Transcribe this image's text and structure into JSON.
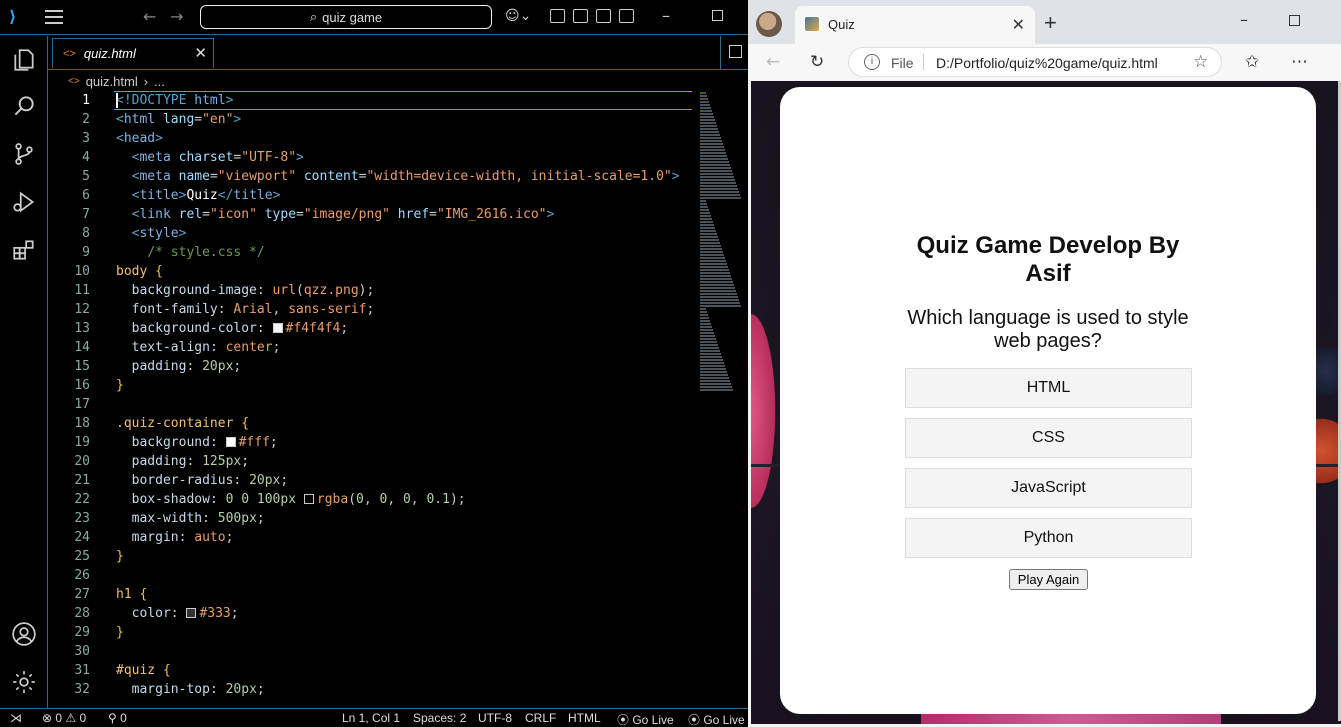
{
  "vscode": {
    "command_center": "quiz game",
    "tab": {
      "icon": "<>",
      "label": "quiz.html"
    },
    "breadcrumb": {
      "file": "quiz.html",
      "rest": "..."
    },
    "lines": [
      {
        "n": "1",
        "tokens": [
          [
            "t-tag",
            "<!DOCTYPE "
          ],
          [
            "t-name",
            "html"
          ],
          [
            "t-tag",
            ">"
          ]
        ]
      },
      {
        "n": "2",
        "tokens": [
          [
            "t-tag",
            "<"
          ],
          [
            "t-name",
            "html "
          ],
          [
            "t-attr",
            "lang"
          ],
          [
            "t-pun",
            "="
          ],
          [
            "t-str",
            "\"en\""
          ],
          [
            "t-tag",
            ">"
          ]
        ]
      },
      {
        "n": "3",
        "tokens": [
          [
            "t-tag",
            "<"
          ],
          [
            "t-name",
            "head"
          ],
          [
            "t-tag",
            ">"
          ]
        ]
      },
      {
        "n": "4",
        "tokens": [
          [
            "t-pun",
            "  "
          ],
          [
            "t-tag",
            "<"
          ],
          [
            "t-name",
            "meta "
          ],
          [
            "t-attr",
            "charset"
          ],
          [
            "t-pun",
            "="
          ],
          [
            "t-str",
            "\"UTF-8\""
          ],
          [
            "t-tag",
            ">"
          ]
        ]
      },
      {
        "n": "5",
        "tokens": [
          [
            "t-pun",
            "  "
          ],
          [
            "t-tag",
            "<"
          ],
          [
            "t-name",
            "meta "
          ],
          [
            "t-attr",
            "name"
          ],
          [
            "t-pun",
            "="
          ],
          [
            "t-str",
            "\"viewport\" "
          ],
          [
            "t-attr",
            "content"
          ],
          [
            "t-pun",
            "="
          ],
          [
            "t-str",
            "\"width=device-width, initial-scale=1.0\""
          ],
          [
            "t-tag",
            ">"
          ]
        ]
      },
      {
        "n": "6",
        "tokens": [
          [
            "t-pun",
            "  "
          ],
          [
            "t-tag",
            "<"
          ],
          [
            "t-name",
            "title"
          ],
          [
            "t-tag",
            ">"
          ],
          [
            "t-txt",
            "Quiz"
          ],
          [
            "t-tag",
            "</"
          ],
          [
            "t-name",
            "title"
          ],
          [
            "t-tag",
            ">"
          ]
        ]
      },
      {
        "n": "7",
        "tokens": [
          [
            "t-pun",
            "  "
          ],
          [
            "t-tag",
            "<"
          ],
          [
            "t-name",
            "link "
          ],
          [
            "t-attr",
            "rel"
          ],
          [
            "t-pun",
            "="
          ],
          [
            "t-str",
            "\"icon\" "
          ],
          [
            "t-attr",
            "type"
          ],
          [
            "t-pun",
            "="
          ],
          [
            "t-str",
            "\"image/png\" "
          ],
          [
            "t-attr",
            "href"
          ],
          [
            "t-pun",
            "="
          ],
          [
            "t-str",
            "\"IMG_2616.ico\""
          ],
          [
            "t-tag",
            ">"
          ]
        ]
      },
      {
        "n": "8",
        "tokens": [
          [
            "t-pun",
            "  "
          ],
          [
            "t-tag",
            "<"
          ],
          [
            "t-name",
            "style"
          ],
          [
            "t-tag",
            ">"
          ]
        ]
      },
      {
        "n": "9",
        "tokens": [
          [
            "t-pun",
            "    "
          ],
          [
            "t-com",
            "/* style.css */"
          ]
        ]
      },
      {
        "n": "10",
        "tokens": [
          [
            "t-sel",
            "body "
          ],
          [
            "t-brace",
            "{"
          ]
        ]
      },
      {
        "n": "11",
        "tokens": [
          [
            "t-pun",
            "  "
          ],
          [
            "t-prop",
            "background-image"
          ],
          [
            "t-pun",
            ": "
          ],
          [
            "t-val",
            "url"
          ],
          [
            "t-pun",
            "("
          ],
          [
            "t-val",
            "qzz.png"
          ],
          [
            "t-pun",
            ");"
          ]
        ]
      },
      {
        "n": "12",
        "tokens": [
          [
            "t-pun",
            "  "
          ],
          [
            "t-prop",
            "font-family"
          ],
          [
            "t-pun",
            ": "
          ],
          [
            "t-val",
            "Arial"
          ],
          [
            "t-pun",
            ", "
          ],
          [
            "t-val",
            "sans-serif"
          ],
          [
            "t-pun",
            ";"
          ]
        ]
      },
      {
        "n": "13",
        "tokens": [
          [
            "t-pun",
            "  "
          ],
          [
            "t-prop",
            "background-color"
          ],
          [
            "t-pun",
            ": "
          ],
          [
            "swatch",
            "#f4f4f4"
          ],
          [
            "t-val",
            "#f4f4f4"
          ],
          [
            "t-pun",
            ";"
          ]
        ]
      },
      {
        "n": "14",
        "tokens": [
          [
            "t-pun",
            "  "
          ],
          [
            "t-prop",
            "text-align"
          ],
          [
            "t-pun",
            ": "
          ],
          [
            "t-val",
            "center"
          ],
          [
            "t-pun",
            ";"
          ]
        ]
      },
      {
        "n": "15",
        "tokens": [
          [
            "t-pun",
            "  "
          ],
          [
            "t-prop",
            "padding"
          ],
          [
            "t-pun",
            ": "
          ],
          [
            "t-num",
            "20px"
          ],
          [
            "t-pun",
            ";"
          ]
        ]
      },
      {
        "n": "16",
        "tokens": [
          [
            "t-brace",
            "}"
          ]
        ]
      },
      {
        "n": "17",
        "tokens": []
      },
      {
        "n": "18",
        "tokens": [
          [
            "t-sel",
            ".quiz-container "
          ],
          [
            "t-brace",
            "{"
          ]
        ]
      },
      {
        "n": "19",
        "tokens": [
          [
            "t-pun",
            "  "
          ],
          [
            "t-prop",
            "background"
          ],
          [
            "t-pun",
            ": "
          ],
          [
            "swatch",
            "#ffffff"
          ],
          [
            "t-val",
            "#fff"
          ],
          [
            "t-pun",
            ";"
          ]
        ]
      },
      {
        "n": "20",
        "tokens": [
          [
            "t-pun",
            "  "
          ],
          [
            "t-prop",
            "padding"
          ],
          [
            "t-pun",
            ": "
          ],
          [
            "t-num",
            "125px"
          ],
          [
            "t-pun",
            ";"
          ]
        ]
      },
      {
        "n": "21",
        "tokens": [
          [
            "t-pun",
            "  "
          ],
          [
            "t-prop",
            "border-radius"
          ],
          [
            "t-pun",
            ": "
          ],
          [
            "t-num",
            "20px"
          ],
          [
            "t-pun",
            ";"
          ]
        ]
      },
      {
        "n": "22",
        "tokens": [
          [
            "t-pun",
            "  "
          ],
          [
            "t-prop",
            "box-shadow"
          ],
          [
            "t-pun",
            ": "
          ],
          [
            "t-num",
            "0 0 100px "
          ],
          [
            "swatch",
            "#000000"
          ],
          [
            "t-val",
            "rgba"
          ],
          [
            "t-pun",
            "("
          ],
          [
            "t-num",
            "0, 0, 0, 0.1"
          ],
          [
            "t-pun",
            ");"
          ]
        ]
      },
      {
        "n": "23",
        "tokens": [
          [
            "t-pun",
            "  "
          ],
          [
            "t-prop",
            "max-width"
          ],
          [
            "t-pun",
            ": "
          ],
          [
            "t-num",
            "500px"
          ],
          [
            "t-pun",
            ";"
          ]
        ]
      },
      {
        "n": "24",
        "tokens": [
          [
            "t-pun",
            "  "
          ],
          [
            "t-prop",
            "margin"
          ],
          [
            "t-pun",
            ": "
          ],
          [
            "t-val",
            "auto"
          ],
          [
            "t-pun",
            ";"
          ]
        ]
      },
      {
        "n": "25",
        "tokens": [
          [
            "t-brace",
            "}"
          ]
        ]
      },
      {
        "n": "26",
        "tokens": []
      },
      {
        "n": "27",
        "tokens": [
          [
            "t-sel",
            "h1 "
          ],
          [
            "t-brace",
            "{"
          ]
        ]
      },
      {
        "n": "28",
        "tokens": [
          [
            "t-pun",
            "  "
          ],
          [
            "t-prop",
            "color"
          ],
          [
            "t-pun",
            ": "
          ],
          [
            "swatch",
            "#333333"
          ],
          [
            "t-val",
            "#333"
          ],
          [
            "t-pun",
            ";"
          ]
        ]
      },
      {
        "n": "29",
        "tokens": [
          [
            "t-brace",
            "}"
          ]
        ]
      },
      {
        "n": "30",
        "tokens": []
      },
      {
        "n": "31",
        "tokens": [
          [
            "t-sel",
            "#quiz "
          ],
          [
            "t-brace",
            "{"
          ]
        ]
      },
      {
        "n": "32",
        "tokens": [
          [
            "t-pun",
            "  "
          ],
          [
            "t-prop",
            "margin-top"
          ],
          [
            "t-pun",
            ": "
          ],
          [
            "t-num",
            "20px"
          ],
          [
            "t-pun",
            ";"
          ]
        ]
      }
    ],
    "status": {
      "errors": "0",
      "warnings": "0",
      "ports": "0",
      "position": "Ln 1, Col 1",
      "spaces": "Spaces: 2",
      "encoding": "UTF-8",
      "eol": "CRLF",
      "language": "HTML",
      "golive1": "Go Live",
      "golive2": "Go Live"
    },
    "colors": {
      "accent": "#2a6a8a",
      "cursorline": "#c78a2a"
    }
  },
  "browser": {
    "tab_title": "Quiz",
    "address": {
      "protocol": "File",
      "url": "D:/Portfolio/quiz%20game/quiz.html"
    },
    "page": {
      "title": "Quiz Game Develop By Asif",
      "question": "Which language is used to style web pages?",
      "options": [
        "HTML",
        "CSS",
        "JavaScript",
        "Python"
      ],
      "play_again": "Play Again"
    }
  }
}
